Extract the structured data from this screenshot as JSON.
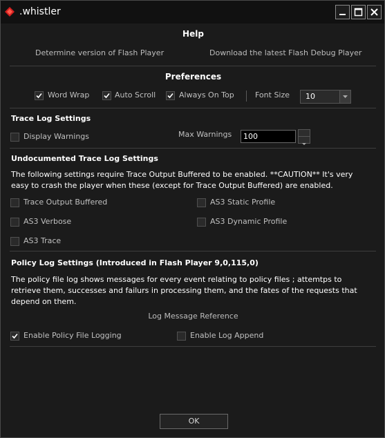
{
  "window": {
    "title": ".whistler"
  },
  "help": {
    "heading": "Help",
    "determine_version_link": "Determine version of Flash Player",
    "download_link": "Download the latest Flash Debug Player"
  },
  "preferences": {
    "heading": "Preferences",
    "word_wrap": {
      "label": "Word Wrap",
      "checked": true
    },
    "auto_scroll": {
      "label": "Auto Scroll",
      "checked": true
    },
    "always_on_top": {
      "label": "Always On Top",
      "checked": true
    },
    "font_size": {
      "label": "Font Size",
      "value": "10"
    }
  },
  "trace_log": {
    "heading": "Trace Log Settings",
    "display_warnings": {
      "label": "Display Warnings",
      "checked": false
    },
    "max_warnings": {
      "label": "Max Warnings",
      "value": "100"
    }
  },
  "undocumented": {
    "heading": "Undocumented Trace Log Settings",
    "description": "The following settings require Trace Output Buffered to be enabled. **CAUTION** It's very easy to crash the player when these (except for Trace Output Buffered) are enabled.",
    "trace_output_buffered": {
      "label": "Trace Output Buffered",
      "checked": false
    },
    "as3_static_profile": {
      "label": "AS3 Static Profile",
      "checked": false
    },
    "as3_verbose": {
      "label": "AS3 Verbose",
      "checked": false
    },
    "as3_dynamic_profile": {
      "label": "AS3 Dynamic Profile",
      "checked": false
    },
    "as3_trace": {
      "label": "AS3 Trace",
      "checked": false
    }
  },
  "policy": {
    "heading": "Policy Log Settings (Introduced in Flash Player 9,0,115,0)",
    "description": "The policy file log shows messages for every event relating to policy files ; attemtps to retrieve them, successes and failurs in processing them, and the fates of the requests that depend on them.",
    "reference_link": "Log Message Reference",
    "enable_policy_logging": {
      "label": "Enable Policy File Logging",
      "checked": true
    },
    "enable_log_append": {
      "label": "Enable Log Append",
      "checked": false
    }
  },
  "ok_button": "OK",
  "colors": {
    "background": "#1b1b1b",
    "titlebar": "#111111",
    "icon_red": "#d42020"
  },
  "icons": {
    "app": "red-diamond-icon",
    "minimize": "minimize-icon",
    "maximize": "maximize-icon",
    "close": "close-icon"
  }
}
